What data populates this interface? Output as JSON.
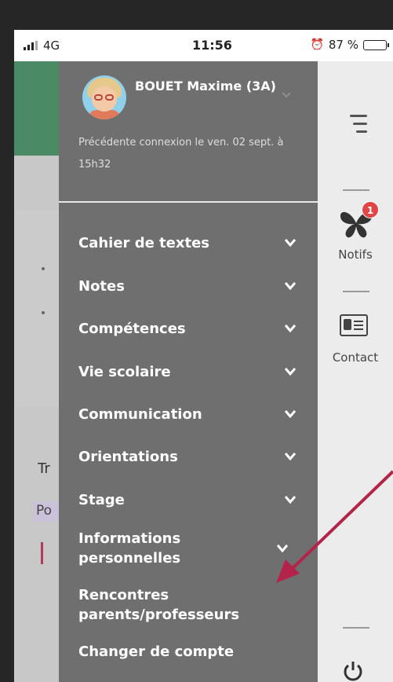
{
  "status_bar": {
    "network": "4G",
    "time": "11:56",
    "battery": "87 %",
    "battery_level": 0.87
  },
  "profile": {
    "name": "BOUET Maxime (3A)",
    "last_connection": "Précédente connexion le ven. 02 sept. à 15h32"
  },
  "menu": {
    "items": [
      {
        "label": "Cahier de textes"
      },
      {
        "label": "Notes"
      },
      {
        "label": "Compétences"
      },
      {
        "label": "Vie scolaire"
      },
      {
        "label": "Communication"
      },
      {
        "label": "Orientations"
      },
      {
        "label": "Stage"
      },
      {
        "label": "Informations personnelles"
      },
      {
        "label": "Rencontres parents/professeurs"
      },
      {
        "label": "Changer de compte"
      }
    ]
  },
  "rail": {
    "notifs_label": "Notifs",
    "notifs_count": "1",
    "contact_label": "Contact"
  },
  "background": {
    "tab_text": "Tr",
    "chip_text": "Po"
  },
  "colors": {
    "drawer": "#6f6f6f",
    "rail": "#ececec",
    "badge": "#e14646",
    "arrow": "#b4234a"
  }
}
